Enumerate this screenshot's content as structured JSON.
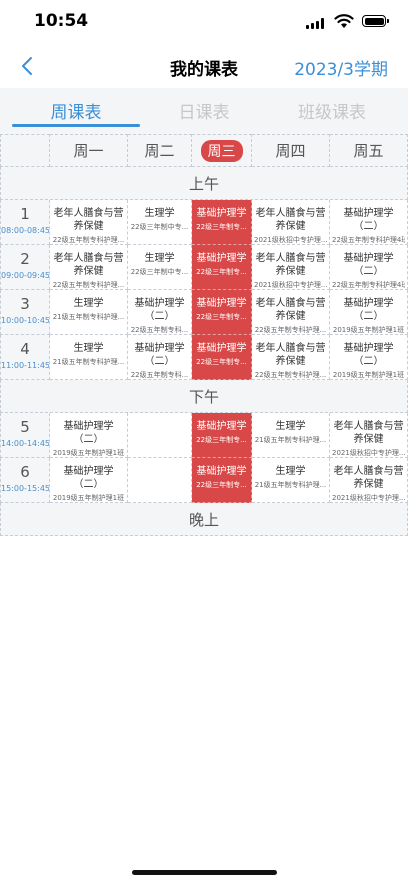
{
  "status_bar": {
    "time": "10:54"
  },
  "nav": {
    "title": "我的课表",
    "term": "2023/3学期"
  },
  "tabs": [
    {
      "label": "周课表",
      "active": true
    },
    {
      "label": "日课表",
      "active": false
    },
    {
      "label": "班级课表",
      "active": false
    }
  ],
  "days": [
    "周一",
    "周二",
    "周三",
    "周四",
    "周五"
  ],
  "today_index": 2,
  "sections": {
    "morning": "上午",
    "afternoon": "下午",
    "evening": "晚上"
  },
  "periods": [
    {
      "num": "1",
      "time": "08:00-08:45"
    },
    {
      "num": "2",
      "time": "09:00-09:45"
    },
    {
      "num": "3",
      "time": "10:00-10:45"
    },
    {
      "num": "4",
      "time": "11:00-11:45"
    },
    {
      "num": "5",
      "time": "14:00-14:45"
    },
    {
      "num": "6",
      "time": "15:00-15:45"
    }
  ],
  "schedule": [
    [
      {
        "name": "老年人膳食与营养保健",
        "cls": "22级五年制专科护理..."
      },
      {
        "name": "生理学",
        "cls": "22级三年制中专..."
      },
      {
        "name": "基础护理学",
        "cls": "22级三年制专..."
      },
      {
        "name": "老年人膳食与营养保健",
        "cls": "2021级秋招中专护理..."
      },
      {
        "name": "基础护理学（二）",
        "cls": "22级五年制专科护理4班"
      }
    ],
    [
      {
        "name": "老年人膳食与营养保健",
        "cls": "22级五年制专科护理..."
      },
      {
        "name": "生理学",
        "cls": "22级三年制中专..."
      },
      {
        "name": "基础护理学",
        "cls": "22级三年制专..."
      },
      {
        "name": "老年人膳食与营养保健",
        "cls": "2021级秋招中专护理..."
      },
      {
        "name": "基础护理学（二）",
        "cls": "22级五年制专科护理4班"
      }
    ],
    [
      {
        "name": "生理学",
        "cls": "21级五年制专科护理..."
      },
      {
        "name": "基础护理学（二）",
        "cls": "22级五年制专科..."
      },
      {
        "name": "基础护理学",
        "cls": "22级三年制专..."
      },
      {
        "name": "老年人膳食与营养保健",
        "cls": "22级五年制专科护理..."
      },
      {
        "name": "基础护理学（二）",
        "cls": "2019级五年制护理1班"
      }
    ],
    [
      {
        "name": "生理学",
        "cls": "21级五年制专科护理..."
      },
      {
        "name": "基础护理学（二）",
        "cls": "22级五年制专科..."
      },
      {
        "name": "基础护理学",
        "cls": "22级三年制专..."
      },
      {
        "name": "老年人膳食与营养保健",
        "cls": "22级五年制专科护理..."
      },
      {
        "name": "基础护理学（二）",
        "cls": "2019级五年制护理1班"
      }
    ],
    [
      {
        "name": "基础护理学（二）",
        "cls": "2019级五年制护理1班"
      },
      null,
      {
        "name": "基础护理学",
        "cls": "22级三年制专..."
      },
      {
        "name": "生理学",
        "cls": "21级五年制专科护理..."
      },
      {
        "name": "老年人膳食与营养保健",
        "cls": "2021级秋招中专护理..."
      }
    ],
    [
      {
        "name": "基础护理学（二）",
        "cls": "2019级五年制护理1班"
      },
      null,
      {
        "name": "基础护理学",
        "cls": "22级三年制专..."
      },
      {
        "name": "生理学",
        "cls": "21级五年制专科护理..."
      },
      {
        "name": "老年人膳食与营养保健",
        "cls": "2021级秋招中专护理..."
      }
    ]
  ]
}
